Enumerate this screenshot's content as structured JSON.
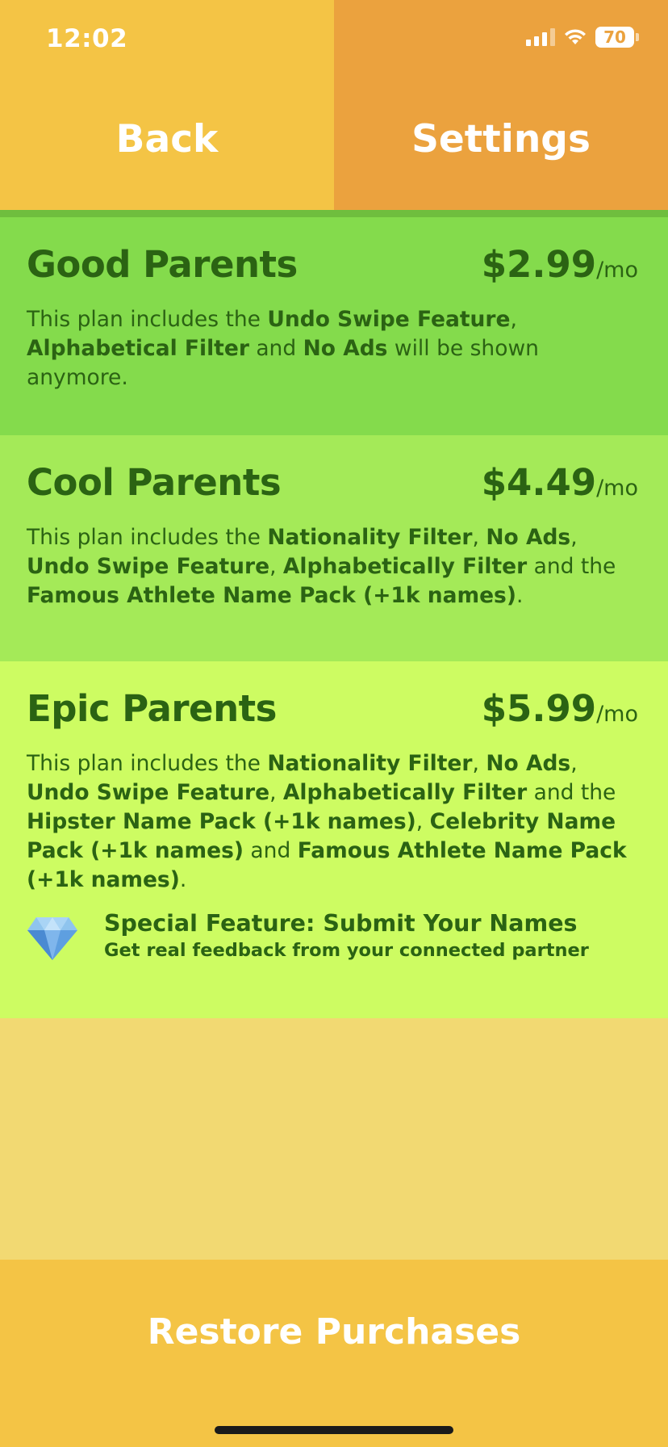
{
  "status_bar": {
    "time": "12:02",
    "battery": "70"
  },
  "nav": {
    "back_label": "Back",
    "settings_label": "Settings"
  },
  "plans": [
    {
      "name": "Good Parents",
      "price": "$2.99",
      "unit": "/mo",
      "description": {
        "t1": "This plan includes the ",
        "b1": "Undo Swipe Feature",
        "t2": ", ",
        "b2": "Alphabetical Filter",
        "t3": " and ",
        "b3": "No Ads",
        "t4": " will be shown anymore."
      }
    },
    {
      "name": "Cool Parents",
      "price": "$4.49",
      "unit": "/mo",
      "description": {
        "t1": "This plan includes the ",
        "b1": "Nationality Filter",
        "t2": ", ",
        "b2": "No Ads",
        "t3": ", ",
        "b3": "Undo Swipe Feature",
        "t4": ", ",
        "b4": "Alphabetically Filter",
        "t5": " and the ",
        "b5": "Famous Athlete Name Pack (+1k names)",
        "t6": "."
      }
    },
    {
      "name": "Epic Parents",
      "price": "$5.99",
      "unit": "/mo",
      "description": {
        "t1": "This plan includes the ",
        "b1": "Nationality Filter",
        "t2": ", ",
        "b2": "No Ads",
        "t3": ", ",
        "b3": "Undo Swipe Feature",
        "t4": ", ",
        "b4": "Alphabetically Filter",
        "t5": " and the ",
        "b5": "Hipster Name Pack (+1k names)",
        "t6": ", ",
        "b6": "Celebrity Name Pack (+1k names)",
        "t7": " and ",
        "b7": "Famous Athlete Name Pack (+1k names)",
        "t8": "."
      },
      "special": {
        "icon": "diamond-icon",
        "title": "Special Feature: Submit Your Names",
        "subtitle": "Get real feedback from your connected partner"
      }
    }
  ],
  "footer": {
    "restore_label": "Restore Purchases"
  },
  "colors": {
    "back_bg": "#F4C445",
    "settings_bg": "#EBA23E",
    "plan_good_bg": "#84DB4C",
    "plan_cool_bg": "#A4EA58",
    "plan_epic_bg": "#CDFC62",
    "text_green": "#2B6313",
    "empty_bg": "#F2D972"
  }
}
